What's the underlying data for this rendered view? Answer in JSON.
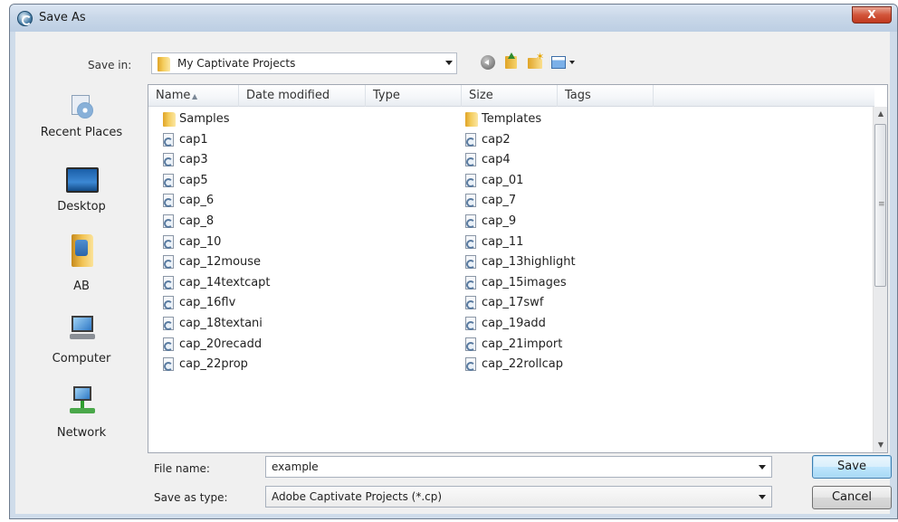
{
  "window": {
    "title": "Save As",
    "close_label": "X"
  },
  "toolbar": {
    "save_in_label": "Save in:",
    "save_in_value": "My Captivate Projects",
    "icons": [
      "back-icon",
      "up-folder-icon",
      "new-folder-icon",
      "view-menu-icon"
    ]
  },
  "places": [
    {
      "label": "Recent Places",
      "icon": "recent-places-icon"
    },
    {
      "label": "Desktop",
      "icon": "desktop-icon"
    },
    {
      "label": "AB",
      "icon": "user-folder-icon"
    },
    {
      "label": "Computer",
      "icon": "computer-icon"
    },
    {
      "label": "Network",
      "icon": "network-icon"
    }
  ],
  "columns": [
    "Name",
    "Date modified",
    "Type",
    "Size",
    "Tags"
  ],
  "files_left": [
    {
      "name": "Samples",
      "kind": "folder"
    },
    {
      "name": "cap1",
      "kind": "cp"
    },
    {
      "name": "cap3",
      "kind": "cp"
    },
    {
      "name": "cap5",
      "kind": "cp"
    },
    {
      "name": "cap_6",
      "kind": "cp"
    },
    {
      "name": "cap_8",
      "kind": "cp"
    },
    {
      "name": "cap_10",
      "kind": "cp"
    },
    {
      "name": "cap_12mouse",
      "kind": "cp"
    },
    {
      "name": "cap_14textcapt",
      "kind": "cp"
    },
    {
      "name": "cap_16flv",
      "kind": "cp"
    },
    {
      "name": "cap_18textani",
      "kind": "cp"
    },
    {
      "name": "cap_20recadd",
      "kind": "cp"
    },
    {
      "name": "cap_22prop",
      "kind": "cp"
    }
  ],
  "files_right": [
    {
      "name": "Templates",
      "kind": "folder"
    },
    {
      "name": "cap2",
      "kind": "cp"
    },
    {
      "name": "cap4",
      "kind": "cp"
    },
    {
      "name": "cap_01",
      "kind": "cp"
    },
    {
      "name": "cap_7",
      "kind": "cp"
    },
    {
      "name": "cap_9",
      "kind": "cp"
    },
    {
      "name": "cap_11",
      "kind": "cp"
    },
    {
      "name": "cap_13highlight",
      "kind": "cp"
    },
    {
      "name": "cap_15images",
      "kind": "cp"
    },
    {
      "name": "cap_17swf",
      "kind": "cp"
    },
    {
      "name": "cap_19add",
      "kind": "cp"
    },
    {
      "name": "cap_21import",
      "kind": "cp"
    },
    {
      "name": "cap_22rollcap",
      "kind": "cp"
    }
  ],
  "form": {
    "file_name_label": "File name:",
    "file_name_value": "example",
    "save_type_label": "Save as type:",
    "save_type_value": "Adobe Captivate Projects (*.cp)"
  },
  "buttons": {
    "save": "Save",
    "cancel": "Cancel"
  }
}
